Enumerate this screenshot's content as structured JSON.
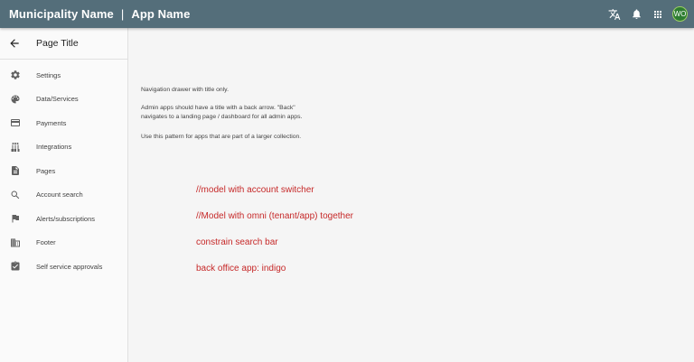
{
  "appbar": {
    "municipality": "Municipality Name",
    "separator": "|",
    "app_name": "App Name",
    "avatar_initials": "WO",
    "colors": {
      "background": "#546e7a",
      "avatar": "#2e7d32"
    },
    "icons": [
      "translate-icon",
      "notifications-icon",
      "apps-grid-icon"
    ]
  },
  "drawer": {
    "page_title": "Page Title",
    "items": [
      {
        "label": "Settings",
        "icon": "gear-icon"
      },
      {
        "label": "Data/Services",
        "icon": "palette-icon"
      },
      {
        "label": "Payments",
        "icon": "credit-card-icon"
      },
      {
        "label": "Integrations",
        "icon": "tune-icon"
      },
      {
        "label": "Pages",
        "icon": "page-icon"
      },
      {
        "label": "Account search",
        "icon": "search-icon"
      },
      {
        "label": "Alerts/subscriptions",
        "icon": "flag-icon"
      },
      {
        "label": "Footer",
        "icon": "building-icon"
      },
      {
        "label": "Self service approvals",
        "icon": "clipboard-check-icon"
      }
    ]
  },
  "main": {
    "description": {
      "line1": "Navigation drawer with title only.",
      "line2a": "Admin apps should have a title with a back arrow. \"Back\"",
      "line2b": "navigates to a landing page / dashboard for all admin apps.",
      "line3": "Use this pattern for apps that are part of a larger collection."
    },
    "notes": [
      "//model with account switcher",
      "//Model with omni (tenant/app) together",
      "constrain search bar",
      "back office app: indigo"
    ],
    "note_color": "#c62828"
  }
}
